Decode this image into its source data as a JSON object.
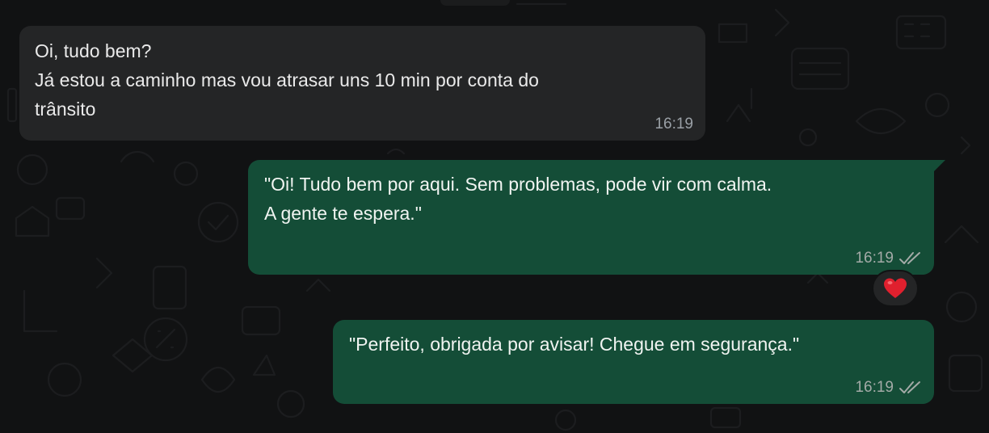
{
  "messages": [
    {
      "direction": "incoming",
      "lines": [
        "Oi, tudo bem?",
        "Já estou a caminho mas vou atrasar uns 10 min por conta do",
        "trânsito"
      ],
      "time": "16:19"
    },
    {
      "direction": "outgoing",
      "lines": [
        "\"Oi! Tudo bem por aqui. Sem problemas, pode vir com calma.",
        "A gente te espera.\""
      ],
      "time": "16:19",
      "status": "read",
      "reaction": "heart-emoji"
    },
    {
      "direction": "outgoing",
      "lines": [
        "\"Perfeito, obrigada por avisar! Chegue em segurança.\""
      ],
      "time": "16:19",
      "status": "read"
    }
  ],
  "colors": {
    "background": "#111213",
    "incoming_bubble": "#242526",
    "outgoing_bubble": "#144d37",
    "reaction_heart": "#e0202e"
  }
}
